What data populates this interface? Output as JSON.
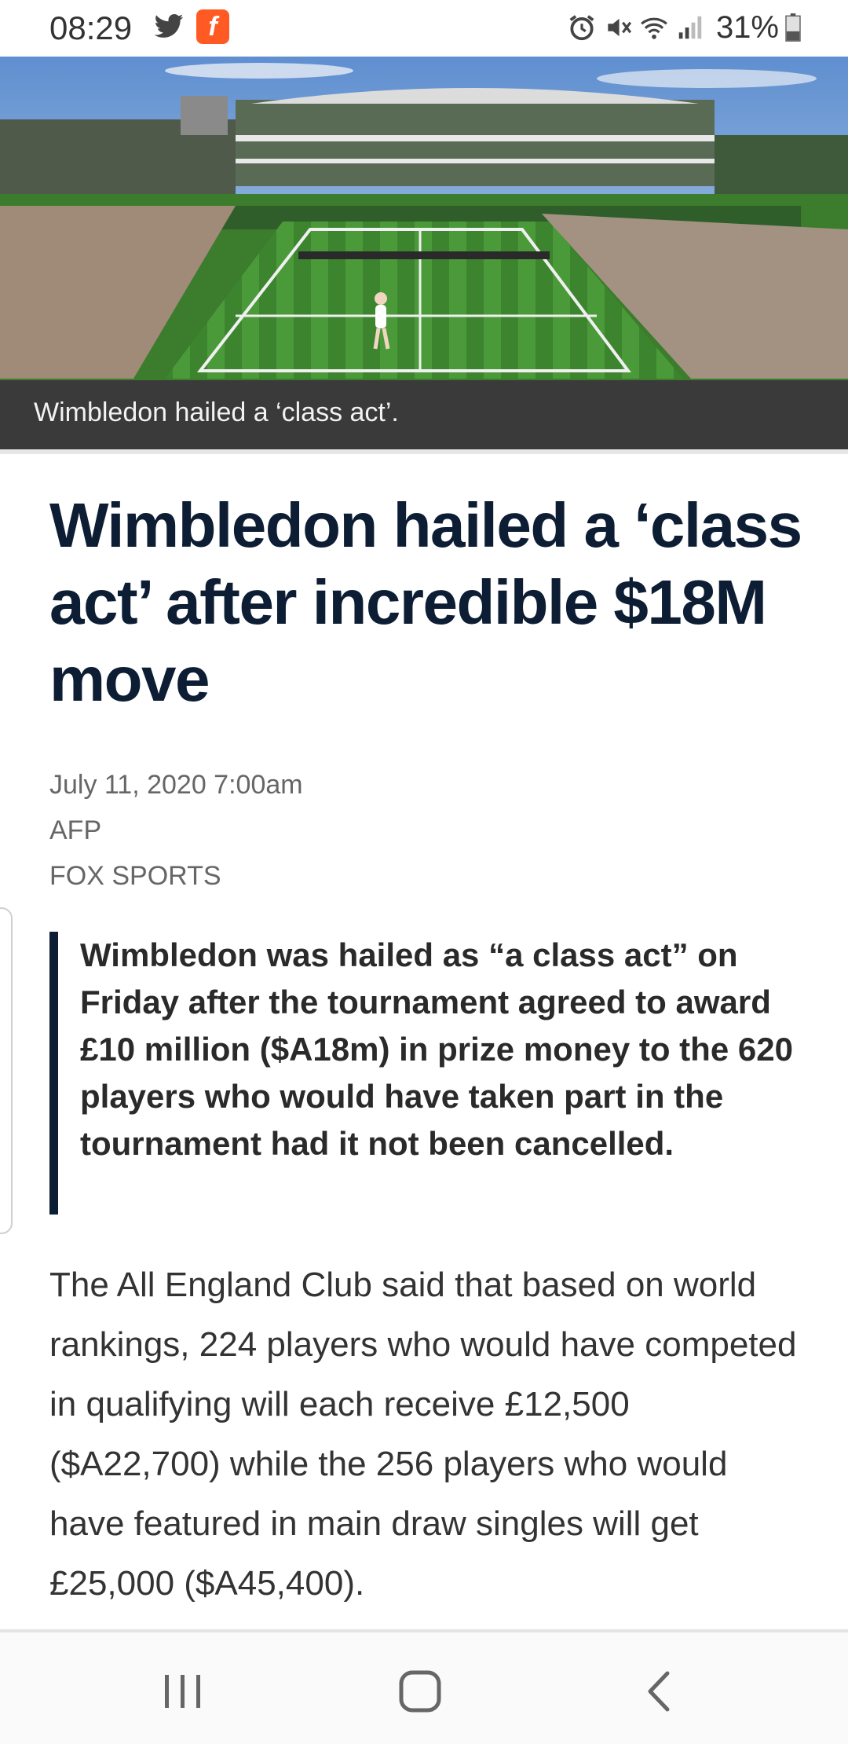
{
  "status_bar": {
    "time": "08:29",
    "battery_percent": "31%",
    "notification_icons": [
      "twitter-icon",
      "flash-app-icon"
    ],
    "system_icons": [
      "alarm-icon",
      "mute-icon",
      "wifi-icon",
      "signal-icon",
      "battery-icon"
    ]
  },
  "hero": {
    "caption": "Wimbledon hailed a ‘class act’."
  },
  "article": {
    "headline": "Wimbledon hailed a ‘class act’ after incredible $18M move",
    "date": "July 11, 2020 7:00am",
    "source": "AFP",
    "outlet": "FOX SPORTS",
    "intro": "Wimbledon was hailed as “a class act” on Friday after the tournament agreed to award £10 million ($A18m) in prize money to the 620 players who would have taken part in the tournament had it not been cancelled.",
    "body": "The All England Club said that based on world rankings, 224 players who would have competed in qualifying will each receive £12,500 ($A22,700) while the 256 players who would have featured in main draw singles will get £25,000 ($A45,400)."
  },
  "nav_bar": {
    "buttons": [
      "recents",
      "home",
      "back"
    ]
  },
  "colors": {
    "headline": "#0d1d33",
    "caption_bg": "#3a3a3a",
    "flash_icon": "#ff5a24",
    "grass": "#3f8a32"
  }
}
